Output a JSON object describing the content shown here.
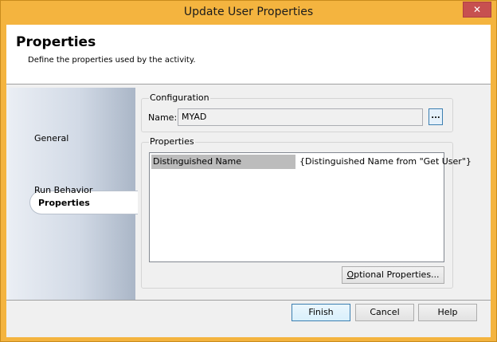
{
  "window": {
    "title": "Update User Properties",
    "close_glyph": "✕"
  },
  "header": {
    "title": "Properties",
    "subtitle": "Define the properties used by the activity."
  },
  "nav": {
    "items": [
      {
        "label": "General"
      },
      {
        "label": "Properties",
        "selected": true
      },
      {
        "label": "Run Behavior"
      }
    ]
  },
  "configuration": {
    "group_label": "Configuration",
    "name_label": "Name:",
    "name_value": "MYAD",
    "browse_label": "..."
  },
  "properties": {
    "group_label": "Properties",
    "rows": [
      {
        "key": "Distinguished Name",
        "value": "{Distinguished Name from \"Get User\"}"
      }
    ],
    "optional_button": {
      "prefix": "",
      "access_key": "O",
      "rest": "ptional Properties..."
    }
  },
  "footer": {
    "finish_label": "Finish",
    "cancel_label": "Cancel",
    "help_label": "Help"
  },
  "colors": {
    "title_bar": "#f4b43f",
    "close_button": "#c75050",
    "selected_row": "#bcbcbc",
    "nav_gradient_end": "#aab6c7"
  }
}
